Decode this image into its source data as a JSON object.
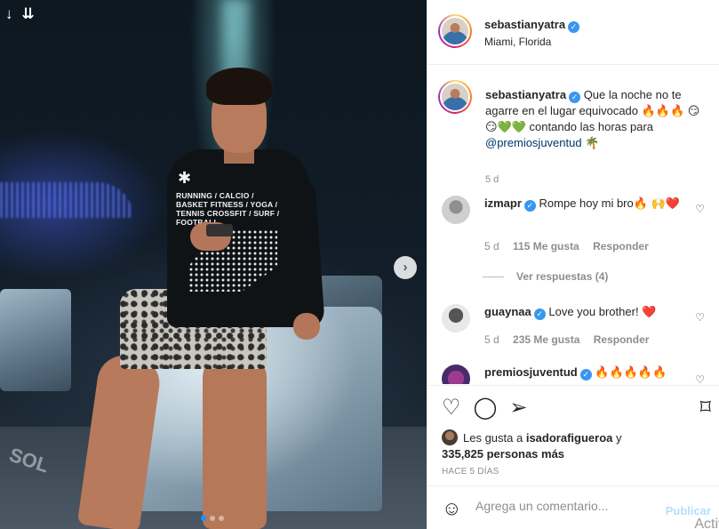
{
  "post": {
    "username": "sebastianyatra",
    "location": "Miami, Florida",
    "shirt_text": "RUNNING / CALCIO / BASKET FITNESS / YOGA / TENNIS CROSSFIT / SURF / FOOTBALL",
    "floor_text": "SOL"
  },
  "caption": {
    "username": "sebastianyatra",
    "text": "Que la noche no te agarre en el lugar equivocado 🔥🔥🔥 😏😏💚💚 contando las horas para",
    "mention": "@premiosjuventud",
    "emoji_tail": "🌴",
    "time": "5 d"
  },
  "comments": [
    {
      "username": "izmapr",
      "text": "Rompe hoy mi bro🔥 🙌❤️",
      "time": "5 d",
      "likes": "115 Me gusta",
      "reply": "Responder"
    },
    {
      "username": "guaynaa",
      "text": "Love you brother! ❤️",
      "time": "5 d",
      "likes": "235 Me gusta",
      "reply": "Responder"
    },
    {
      "username": "premiosjuventud",
      "text": "🔥🔥🔥🔥🔥"
    }
  ],
  "view_replies": "Ver respuestas (4)",
  "likes": {
    "prefix": "Les gusta a",
    "user": "isadorafigueroa",
    "joiner": "y",
    "count": "335,825 personas más"
  },
  "posted_ago": "HACE 5 DÍAS",
  "add_comment": {
    "placeholder": "Agrega un comentario...",
    "publish": "Publicar",
    "watermark": "Activ"
  },
  "colors": {
    "verified": "#3897f0",
    "link": "#00376b",
    "publish": "#b2dffc",
    "muted": "#8e8e8e",
    "carousel_active": "#1e90ff"
  },
  "icons": [
    "down-arrow-icon",
    "double-down-arrow-icon",
    "next-arrow-icon",
    "heart-icon",
    "comment-icon",
    "share-icon",
    "bookmark-icon",
    "smiley-icon",
    "verified-badge-icon"
  ]
}
